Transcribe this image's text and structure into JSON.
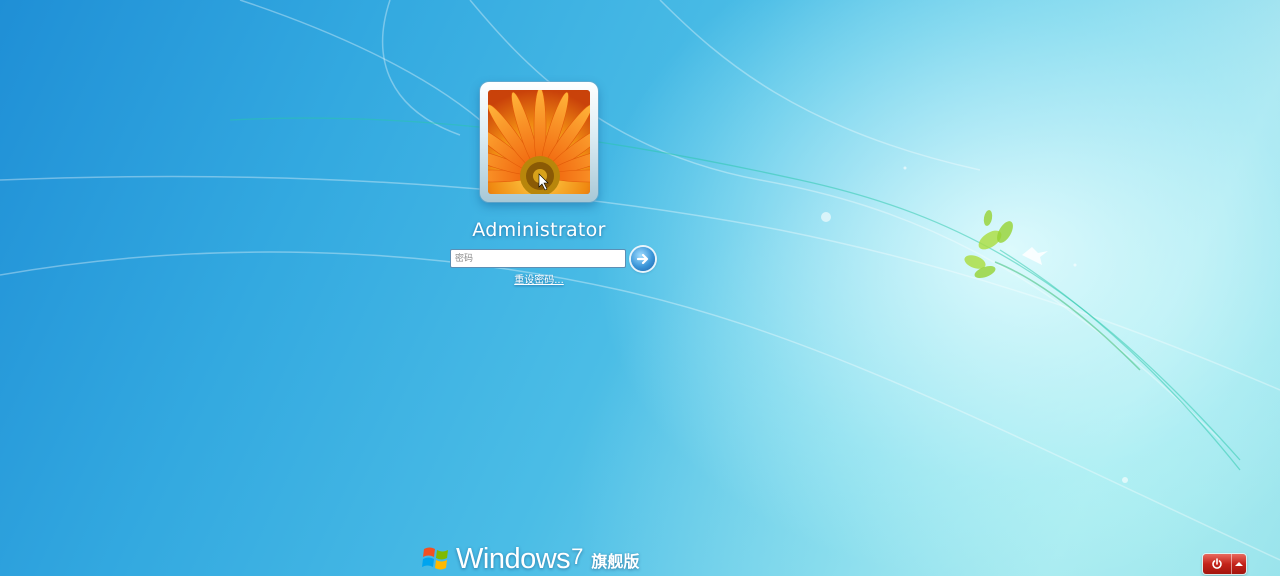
{
  "user": {
    "name": "Administrator",
    "avatar_icon": "orange-flower-icon"
  },
  "login": {
    "password_placeholder": "密码",
    "submit_icon": "arrow-right-icon",
    "reset_password_label": "重设密码..."
  },
  "branding": {
    "logo_icon": "windows-flag-icon",
    "product_name": "Windows",
    "version": "7",
    "edition": "旗舰版"
  },
  "power": {
    "shutdown_icon": "power-icon",
    "menu_icon": "triangle-up-icon"
  },
  "colors": {
    "background_blue": "#33a9e0",
    "power_red": "#c4231a"
  }
}
